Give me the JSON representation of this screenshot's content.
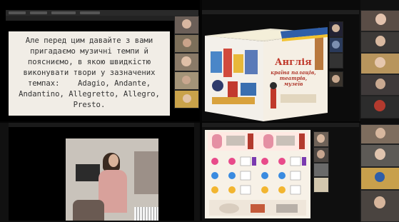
{
  "quadrants": {
    "top_left": {
      "browser_tabs": [
        "",
        "",
        "",
        ""
      ],
      "slide_text": "Але перед цим давайте з вами пригадаємо музичні темпи й поясниємо, в якою швидкістю виконувати твори у зазначених темпах:    Adagio, Andante, Andantino, Allegretto, Allegro, Presto."
    },
    "top_right": {
      "cube_title": "Англія",
      "cube_subtitle": "країна палаців, театрів, музеїв"
    },
    "bottom_left": {
      "window_title": ""
    },
    "bottom_right": {
      "window_title": ""
    }
  },
  "colors": {
    "slide_bg": "#f1ede6",
    "slide_text": "#333333",
    "cube_title": "#c0392b",
    "frame_bg": "#111111"
  }
}
